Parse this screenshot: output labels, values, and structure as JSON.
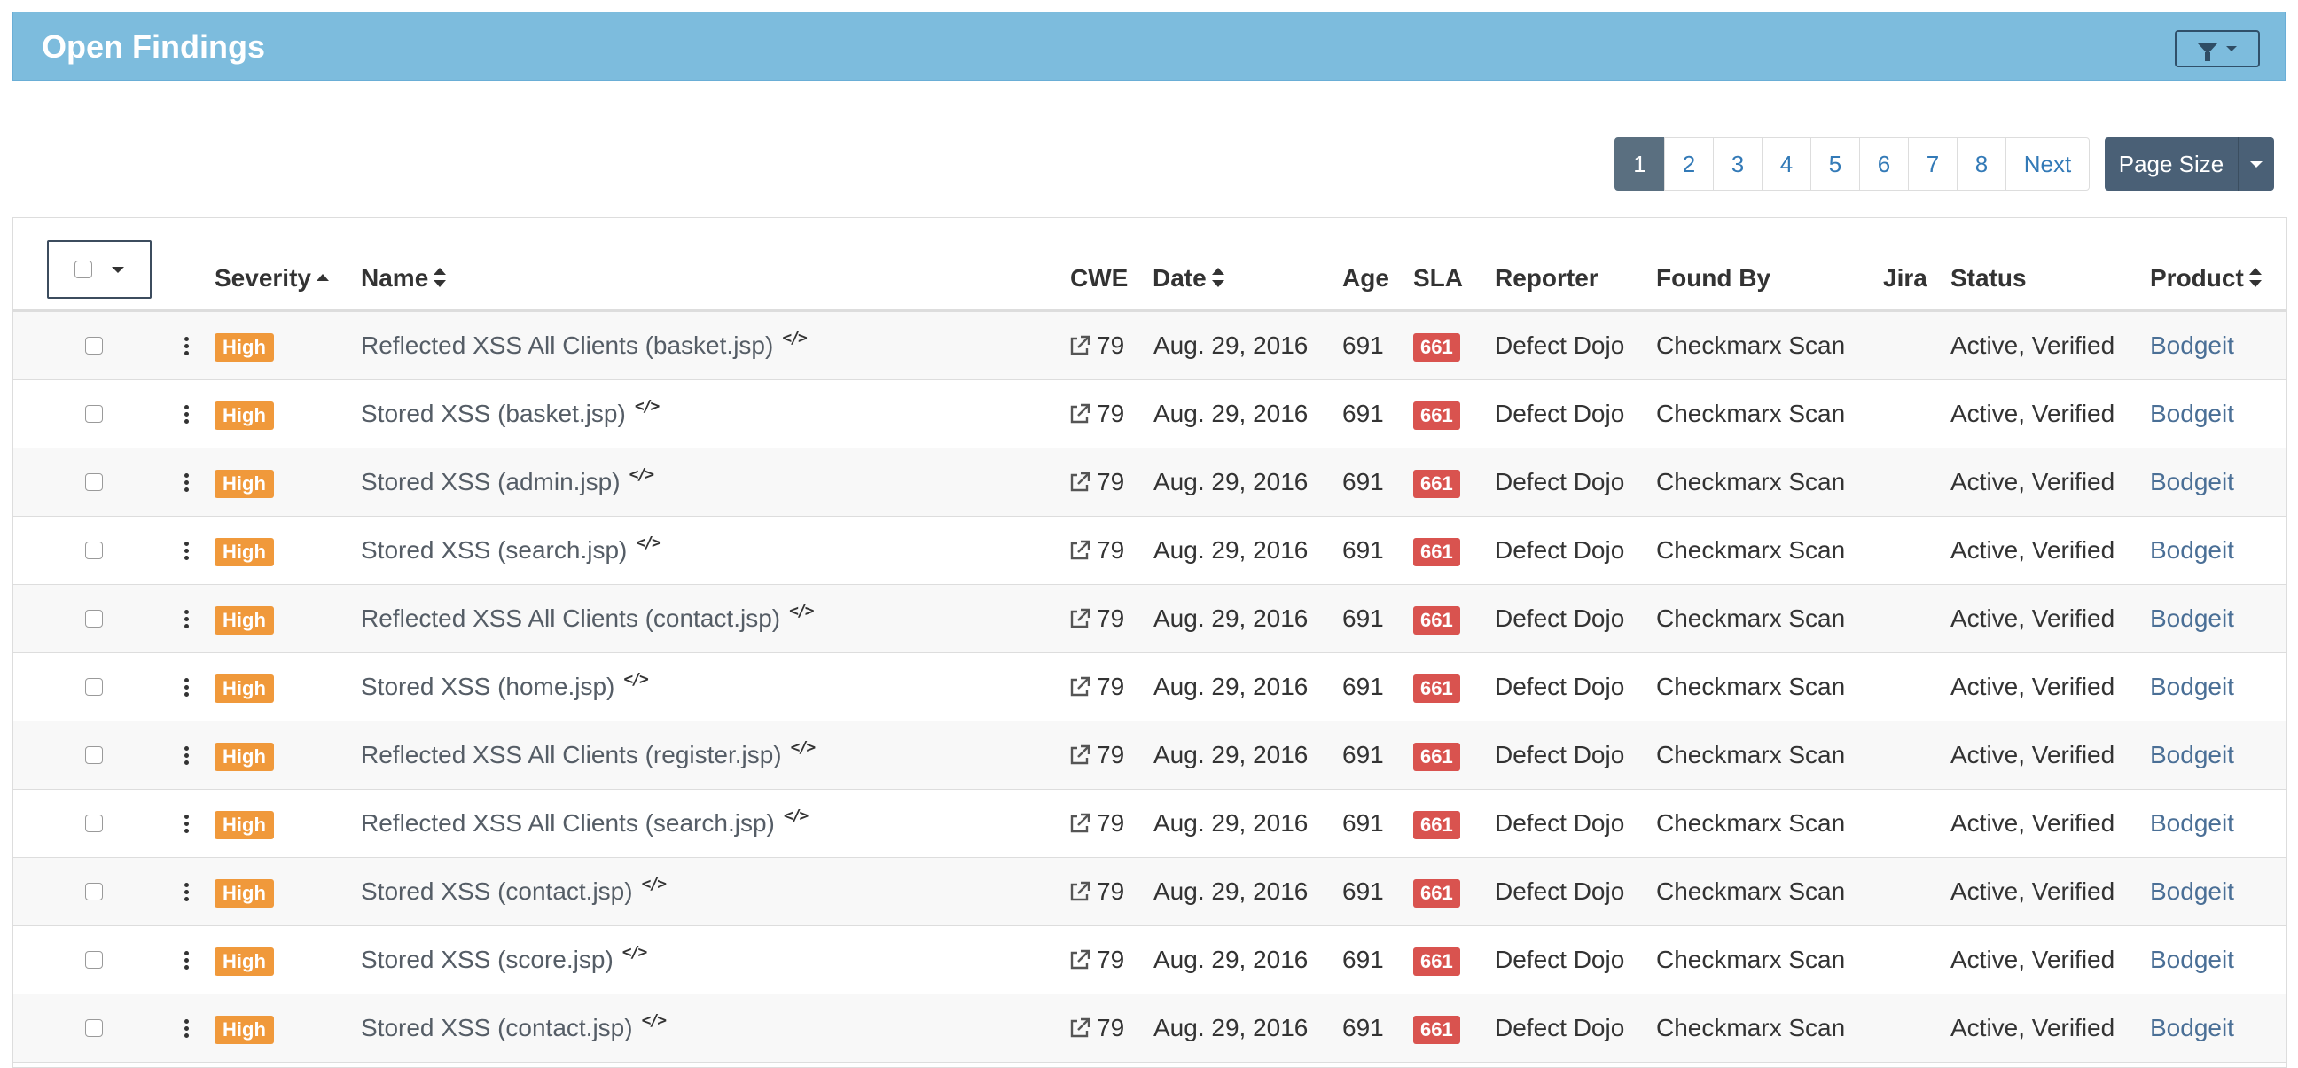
{
  "panel": {
    "title": "Open Findings",
    "filter_icon": "filter-icon"
  },
  "pagination": {
    "pages": [
      "1",
      "2",
      "3",
      "4",
      "5",
      "6",
      "7",
      "8"
    ],
    "active": "1",
    "next_label": "Next",
    "page_size_label": "Page Size"
  },
  "table": {
    "headers": {
      "severity": "Severity",
      "name": "Name",
      "cwe": "CWE",
      "date": "Date",
      "age": "Age",
      "sla": "SLA",
      "reporter": "Reporter",
      "found_by": "Found By",
      "jira": "Jira",
      "status": "Status",
      "product": "Product"
    },
    "rows": [
      {
        "severity": "High",
        "name": "Reflected XSS All Clients (basket.jsp)",
        "cwe": "79",
        "date": "Aug. 29, 2016",
        "age": "691",
        "sla": "661",
        "reporter": "Defect Dojo",
        "found_by": "Checkmarx Scan",
        "status": "Active, Verified",
        "product": "Bodgeit"
      },
      {
        "severity": "High",
        "name": "Stored XSS (basket.jsp)",
        "cwe": "79",
        "date": "Aug. 29, 2016",
        "age": "691",
        "sla": "661",
        "reporter": "Defect Dojo",
        "found_by": "Checkmarx Scan",
        "status": "Active, Verified",
        "product": "Bodgeit"
      },
      {
        "severity": "High",
        "name": "Stored XSS (admin.jsp)",
        "cwe": "79",
        "date": "Aug. 29, 2016",
        "age": "691",
        "sla": "661",
        "reporter": "Defect Dojo",
        "found_by": "Checkmarx Scan",
        "status": "Active, Verified",
        "product": "Bodgeit"
      },
      {
        "severity": "High",
        "name": "Stored XSS (search.jsp)",
        "cwe": "79",
        "date": "Aug. 29, 2016",
        "age": "691",
        "sla": "661",
        "reporter": "Defect Dojo",
        "found_by": "Checkmarx Scan",
        "status": "Active, Verified",
        "product": "Bodgeit"
      },
      {
        "severity": "High",
        "name": "Reflected XSS All Clients (contact.jsp)",
        "cwe": "79",
        "date": "Aug. 29, 2016",
        "age": "691",
        "sla": "661",
        "reporter": "Defect Dojo",
        "found_by": "Checkmarx Scan",
        "status": "Active, Verified",
        "product": "Bodgeit"
      },
      {
        "severity": "High",
        "name": "Stored XSS (home.jsp)",
        "cwe": "79",
        "date": "Aug. 29, 2016",
        "age": "691",
        "sla": "661",
        "reporter": "Defect Dojo",
        "found_by": "Checkmarx Scan",
        "status": "Active, Verified",
        "product": "Bodgeit"
      },
      {
        "severity": "High",
        "name": "Reflected XSS All Clients (register.jsp)",
        "cwe": "79",
        "date": "Aug. 29, 2016",
        "age": "691",
        "sla": "661",
        "reporter": "Defect Dojo",
        "found_by": "Checkmarx Scan",
        "status": "Active, Verified",
        "product": "Bodgeit"
      },
      {
        "severity": "High",
        "name": "Reflected XSS All Clients (search.jsp)",
        "cwe": "79",
        "date": "Aug. 29, 2016",
        "age": "691",
        "sla": "661",
        "reporter": "Defect Dojo",
        "found_by": "Checkmarx Scan",
        "status": "Active, Verified",
        "product": "Bodgeit"
      },
      {
        "severity": "High",
        "name": "Stored XSS (contact.jsp)",
        "cwe": "79",
        "date": "Aug. 29, 2016",
        "age": "691",
        "sla": "661",
        "reporter": "Defect Dojo",
        "found_by": "Checkmarx Scan",
        "status": "Active, Verified",
        "product": "Bodgeit"
      },
      {
        "severity": "High",
        "name": "Stored XSS (score.jsp)",
        "cwe": "79",
        "date": "Aug. 29, 2016",
        "age": "691",
        "sla": "661",
        "reporter": "Defect Dojo",
        "found_by": "Checkmarx Scan",
        "status": "Active, Verified",
        "product": "Bodgeit"
      },
      {
        "severity": "High",
        "name": "Stored XSS (contact.jsp)",
        "cwe": "79",
        "date": "Aug. 29, 2016",
        "age": "691",
        "sla": "661",
        "reporter": "Defect Dojo",
        "found_by": "Checkmarx Scan",
        "status": "Active, Verified",
        "product": "Bodgeit"
      }
    ]
  },
  "colors": {
    "header_bg": "#7dbcdd",
    "severity_high": "#f0993b",
    "sla_badge": "#d9534f",
    "active_page": "#5a6f80"
  }
}
